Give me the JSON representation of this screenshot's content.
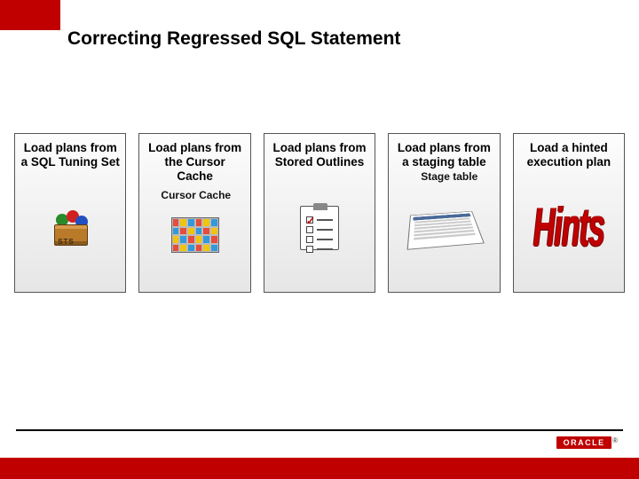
{
  "title": "Correcting Regressed SQL Statement",
  "cards": [
    {
      "title": "Load plans from a SQL Tuning Set",
      "caption": ""
    },
    {
      "title": "Load plans from the Cursor Cache",
      "caption": "Cursor Cache"
    },
    {
      "title": "Load plans from Stored Outlines",
      "caption": ""
    },
    {
      "title": "Load plans from a staging table",
      "caption": "Stage table"
    },
    {
      "title": "Load a hinted execution plan",
      "caption": "Hints"
    }
  ],
  "footer": {
    "logo": "ORACLE",
    "reg": "®"
  }
}
